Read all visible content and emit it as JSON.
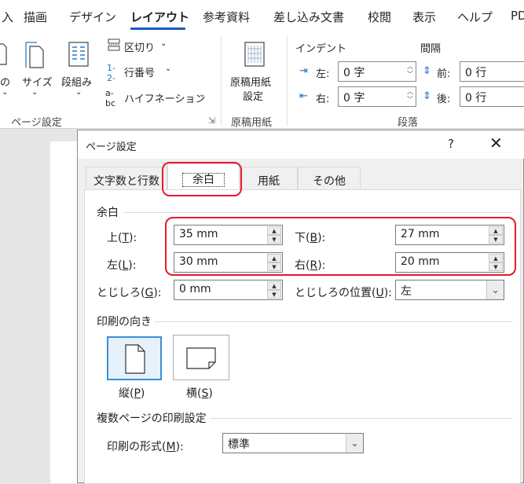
{
  "ribbon_tabs": [
    "入",
    "描画",
    "デザイン",
    "レイアウト",
    "参考資料",
    "差し込み文書",
    "校閲",
    "表示",
    "ヘルプ",
    "PD"
  ],
  "ribbon": {
    "orientation_label": "の",
    "size_label": "サイズ",
    "columns_label": "段組み",
    "breaks_label": "区切り",
    "line_numbers_label": "行番号",
    "hyphenation_label": "ハイフネーション",
    "page_setup_group": "ページ設定",
    "manuscript_label_line1": "原稿用紙",
    "manuscript_label_line2": "設定",
    "manuscript_group": "原稿用紙",
    "indent_title": "インデント",
    "indent_left_label": "左:",
    "indent_left_value": "0 字",
    "indent_right_label": "右:",
    "indent_right_value": "0 字",
    "spacing_title": "間隔",
    "spacing_before_label": "前:",
    "spacing_before_value": "0 行",
    "spacing_after_label": "後:",
    "spacing_after_value": "0 行",
    "paragraph_group": "段落"
  },
  "dialog": {
    "title": "ページ設定",
    "help": "?",
    "close": "✕",
    "tabs": [
      "文字数と行数",
      "余白",
      "用紙",
      "その他"
    ],
    "margins_section": "余白",
    "top_label": "上(",
    "top_key": "T",
    "top_end": "):",
    "top_value": "35 mm",
    "bottom_label": "下(",
    "bottom_key": "B",
    "bottom_end": "):",
    "bottom_value": "27 mm",
    "left_label": "左(",
    "left_key": "L",
    "left_end": "):",
    "left_value": "30 mm",
    "right_label": "右(",
    "right_key": "R",
    "right_end": "):",
    "right_value": "20 mm",
    "gutter_label": "とじしろ(",
    "gutter_key": "G",
    "gutter_end": "):",
    "gutter_value": "0 mm",
    "gutter_pos_label": "とじしろの位置(",
    "gutter_pos_key": "U",
    "gutter_pos_end": "):",
    "gutter_pos_value": "左",
    "orientation_section": "印刷の向き",
    "portrait_label": "縦(",
    "portrait_key": "P",
    "portrait_end": ")",
    "landscape_label": "横(",
    "landscape_key": "S",
    "landscape_end": ")",
    "multi_section": "複数ページの印刷設定",
    "print_format_label": "印刷の形式(",
    "print_format_key": "M",
    "print_format_end": "):",
    "print_format_value": "標準"
  },
  "colors": {
    "accent": "#185abd",
    "highlight": "#e8192c",
    "selection": "#3c8ed6"
  }
}
